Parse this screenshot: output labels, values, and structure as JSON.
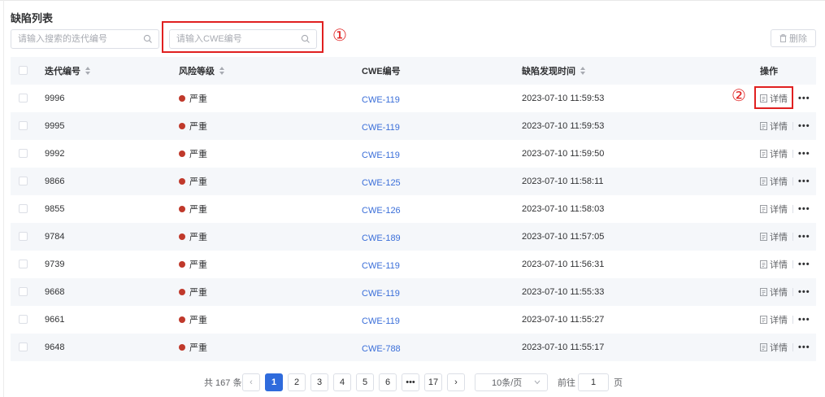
{
  "page_title": "缺陷列表",
  "search_iteration": {
    "placeholder": "请输入搜索的迭代编号",
    "value": ""
  },
  "search_cwe": {
    "placeholder": "请输入CWE编号",
    "value": ""
  },
  "annotations": {
    "one": "①",
    "two": "②"
  },
  "delete_button": {
    "label": "删除"
  },
  "table": {
    "headers": {
      "iteration": "迭代编号",
      "risk": "风险等级",
      "cwe": "CWE编号",
      "time": "缺陷发现时间",
      "operation": "操作"
    },
    "rows": [
      {
        "iteration": "9996",
        "risk": "严重",
        "cwe": "CWE-119",
        "time": "2023-07-10 11:59:53"
      },
      {
        "iteration": "9995",
        "risk": "严重",
        "cwe": "CWE-119",
        "time": "2023-07-10 11:59:53"
      },
      {
        "iteration": "9992",
        "risk": "严重",
        "cwe": "CWE-119",
        "time": "2023-07-10 11:59:50"
      },
      {
        "iteration": "9866",
        "risk": "严重",
        "cwe": "CWE-125",
        "time": "2023-07-10 11:58:11"
      },
      {
        "iteration": "9855",
        "risk": "严重",
        "cwe": "CWE-126",
        "time": "2023-07-10 11:58:03"
      },
      {
        "iteration": "9784",
        "risk": "严重",
        "cwe": "CWE-189",
        "time": "2023-07-10 11:57:05"
      },
      {
        "iteration": "9739",
        "risk": "严重",
        "cwe": "CWE-119",
        "time": "2023-07-10 11:56:31"
      },
      {
        "iteration": "9668",
        "risk": "严重",
        "cwe": "CWE-119",
        "time": "2023-07-10 11:55:33"
      },
      {
        "iteration": "9661",
        "risk": "严重",
        "cwe": "CWE-119",
        "time": "2023-07-10 11:55:27"
      },
      {
        "iteration": "9648",
        "risk": "严重",
        "cwe": "CWE-788",
        "time": "2023-07-10 11:55:17"
      }
    ],
    "detail_label": "详情",
    "more_label": "•••"
  },
  "pagination": {
    "total_text": "共 167 条",
    "pages": [
      "1",
      "2",
      "3",
      "4",
      "5",
      "6",
      "•••",
      "17"
    ],
    "current_page": "1",
    "prev_symbol": "‹",
    "next_symbol": "›",
    "page_size": "10条/页",
    "goto_prefix": "前往",
    "goto_value": "1",
    "goto_suffix": "页"
  },
  "colors": {
    "accent": "#2f6bdc",
    "danger_dot": "#c0392b",
    "annotation": "#e02020",
    "link": "#3b6fd9"
  }
}
